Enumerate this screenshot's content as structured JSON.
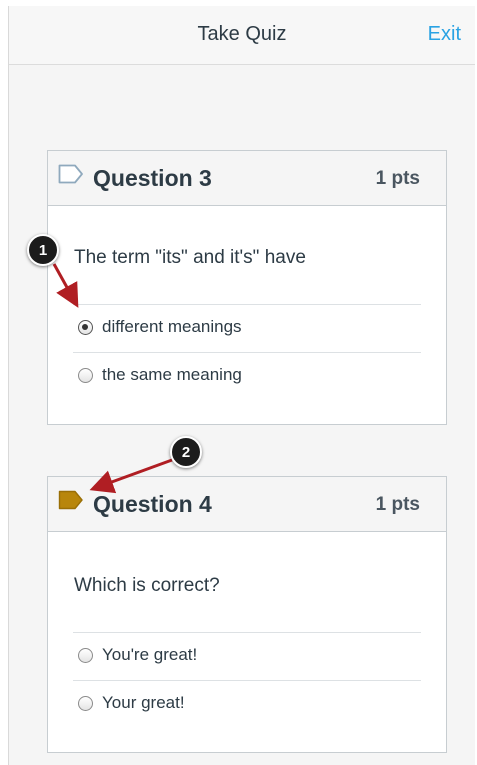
{
  "header": {
    "title": "Take Quiz",
    "exit_label": "Exit"
  },
  "questions": [
    {
      "title": "Question 3",
      "points": "1 pts",
      "flagged": false,
      "text": "The term \"its\" and it's\" have",
      "answers": [
        {
          "label": "different meanings",
          "selected": true
        },
        {
          "label": "the same meaning",
          "selected": false
        }
      ]
    },
    {
      "title": "Question 4",
      "points": "1 pts",
      "flagged": true,
      "text": "Which is correct?",
      "answers": [
        {
          "label": "You're great!",
          "selected": false
        },
        {
          "label": "Your great!",
          "selected": false
        }
      ]
    }
  ],
  "callouts": [
    {
      "number": "1"
    },
    {
      "number": "2"
    }
  ],
  "colors": {
    "accent": "#2aa2e3",
    "flag_active": "#b8860b",
    "flag_inactive": "#8fa9bd",
    "annotation_arrow": "#b01e23"
  }
}
